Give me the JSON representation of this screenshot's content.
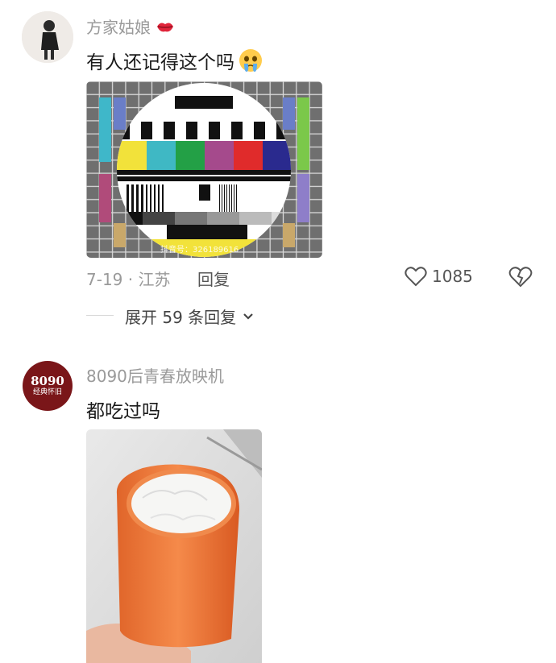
{
  "comment1": {
    "username": "方家姑娘",
    "username_badge": "lips-emoji",
    "text": "有人还记得这个吗",
    "text_emoji": "crying-face-emoji",
    "image_watermark": "抖音号：326189616",
    "date_location": "7-19 · 江苏",
    "reply_label": "回复",
    "like_count": "1085",
    "expand_label": "展开 59 条回复"
  },
  "comment2": {
    "username": "8090后青春放映机",
    "avatar_text_top": "8090",
    "avatar_text_bottom": "经典怀旧",
    "text": "都吃过吗"
  },
  "colors": {
    "avatar2_bg": "#7a1619",
    "popsicle_orange": "#f07a3c",
    "muted_text": "#9a9a9a"
  }
}
